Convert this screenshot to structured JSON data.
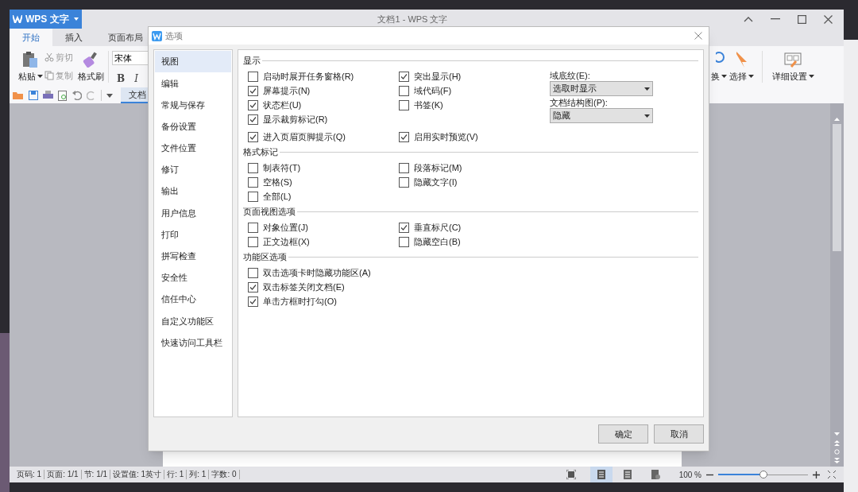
{
  "app": {
    "logo_text": "WPS 文字",
    "title": "文档1 - WPS 文字"
  },
  "ribbon_tabs": [
    {
      "label": "开始",
      "selected": true
    },
    {
      "label": "插入",
      "selected": false
    },
    {
      "label": "页面布局",
      "selected": false
    }
  ],
  "toolbar": {
    "paste": "粘贴",
    "cut": "剪切",
    "copy": "复制",
    "format_painter": "格式刷",
    "font": "宋体",
    "bold": "B",
    "italic": "I",
    "replace_partial": "换",
    "select": "选择",
    "details": "详细设置"
  },
  "doc_tab": "文档",
  "dialog": {
    "title": "选项",
    "nav": [
      {
        "label": "视图",
        "selected": true
      },
      {
        "label": "编辑",
        "selected": false
      },
      {
        "label": "常规与保存",
        "selected": false
      },
      {
        "label": "备份设置",
        "selected": false
      },
      {
        "label": "文件位置",
        "selected": false
      },
      {
        "label": "修订",
        "selected": false
      },
      {
        "label": "输出",
        "selected": false
      },
      {
        "label": "用户信息",
        "selected": false
      },
      {
        "label": "打印",
        "selected": false
      },
      {
        "label": "拼写检查",
        "selected": false
      },
      {
        "label": "安全性",
        "selected": false
      },
      {
        "label": "信任中心",
        "selected": false
      },
      {
        "label": "自定义功能区",
        "selected": false
      },
      {
        "label": "快速访问工具栏",
        "selected": false
      }
    ],
    "sections": [
      {
        "title": "显示",
        "rows": [
          {
            "left": {
              "label": "启动时展开任务窗格(R)",
              "checked": false
            },
            "right": {
              "label": "突出显示(H)",
              "checked": true
            }
          },
          {
            "left": {
              "label": "屏幕提示(N)",
              "checked": true
            },
            "right": {
              "label": "域代码(F)",
              "checked": false
            }
          },
          {
            "left": {
              "label": "状态栏(U)",
              "checked": true
            },
            "right": {
              "label": "书签(K)",
              "checked": false
            }
          },
          {
            "left": {
              "label": "显示裁剪标记(R)",
              "checked": true
            }
          },
          {
            "left": {
              "label": "进入页眉页脚提示(Q)",
              "checked": true
            },
            "right": {
              "label": "启用实时预览(V)",
              "checked": true
            }
          }
        ],
        "dropdowns": [
          {
            "label": "域底纹(E):",
            "value": "选取时显示"
          },
          {
            "label": "文档结构图(P):",
            "value": "隐藏"
          }
        ]
      },
      {
        "title": "格式标记",
        "rows": [
          {
            "left": {
              "label": "制表符(T)",
              "checked": false
            },
            "right": {
              "label": "段落标记(M)",
              "checked": false
            }
          },
          {
            "left": {
              "label": "空格(S)",
              "checked": false
            },
            "right": {
              "label": "隐藏文字(I)",
              "checked": false
            }
          },
          {
            "left": {
              "label": "全部(L)",
              "checked": false
            }
          }
        ]
      },
      {
        "title": "页面视图选项",
        "rows": [
          {
            "left": {
              "label": "对象位置(J)",
              "checked": false
            },
            "right": {
              "label": "垂直标尺(C)",
              "checked": true
            }
          },
          {
            "left": {
              "label": "正文边框(X)",
              "checked": false
            },
            "right": {
              "label": "隐藏空白(B)",
              "checked": false
            }
          }
        ]
      },
      {
        "title": "功能区选项",
        "rows": [
          {
            "left": {
              "label": "双击选项卡时隐藏功能区(A)",
              "checked": false
            }
          },
          {
            "left": {
              "label": "双击标签关闭文档(E)",
              "checked": true
            }
          },
          {
            "left": {
              "label": "单击方框时打勾(O)",
              "checked": true
            }
          }
        ]
      }
    ],
    "buttons": [
      "确定",
      "取消"
    ]
  },
  "status_bar": {
    "items": [
      "页码: 1",
      "页面: 1/1",
      "节: 1/1",
      "设置值: 1英寸",
      "行: 1",
      "列: 1",
      "字数: 0"
    ],
    "zoom": "100 %",
    "zoom_slider": {
      "level": 0.5
    }
  }
}
